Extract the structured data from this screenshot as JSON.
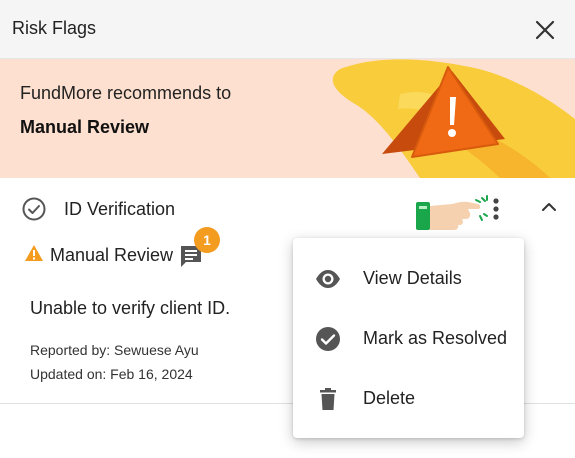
{
  "header": {
    "title": "Risk Flags"
  },
  "banner": {
    "line1": "FundMore recommends to",
    "line2": "Manual Review"
  },
  "flag": {
    "title": "ID Verification",
    "status": "Manual Review",
    "comment_count": "1",
    "description": "Unable to verify client ID.",
    "reported_by": "Reported by: Sewuese Ayu",
    "updated_on": "Updated on: Feb 16, 2024"
  },
  "menu": {
    "items": [
      {
        "label": "View Details",
        "icon": "eye-icon"
      },
      {
        "label": "Mark as Resolved",
        "icon": "check-circle-icon"
      },
      {
        "label": "Delete",
        "icon": "trash-icon"
      }
    ]
  },
  "colors": {
    "accent_orange": "#f39c1f",
    "banner_bg": "#fde0cf",
    "header_bg": "#f5f5f5"
  }
}
